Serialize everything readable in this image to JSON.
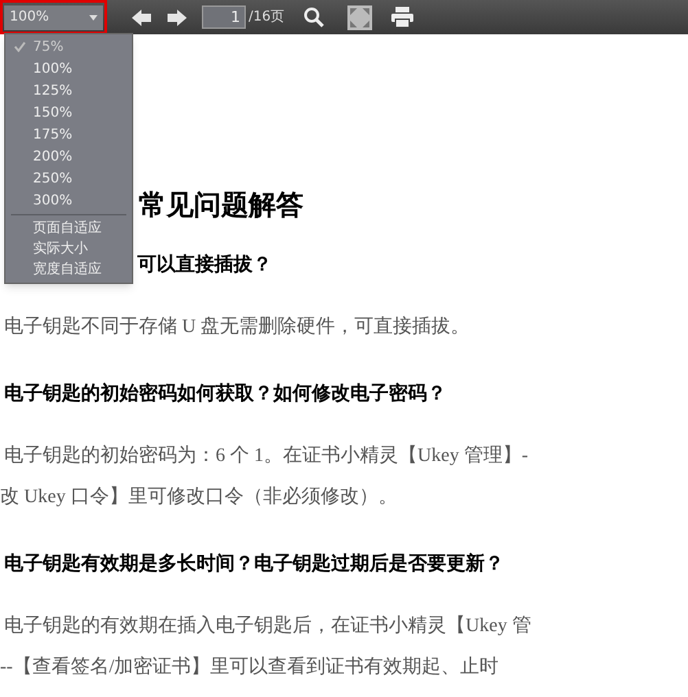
{
  "toolbar": {
    "zoom_value": "100%",
    "page_input": "1",
    "page_total": "/16页"
  },
  "zoom_menu": {
    "items": [
      {
        "label": "75%",
        "selected": true
      },
      {
        "label": "100%",
        "selected": false
      },
      {
        "label": "125%",
        "selected": false
      },
      {
        "label": "150%",
        "selected": false
      },
      {
        "label": "175%",
        "selected": false
      },
      {
        "label": "200%",
        "selected": false
      },
      {
        "label": "250%",
        "selected": false
      },
      {
        "label": "300%",
        "selected": false
      }
    ],
    "fit_items": [
      "页面自适应",
      "实际大小",
      "宽度自适应"
    ]
  },
  "document": {
    "title": "常见问题解答",
    "blocks": [
      {
        "kind": "partial_question",
        "text": "可以直接插拔？"
      },
      {
        "kind": "answer",
        "text": "电子钥匙不同于存储 U 盘无需删除硬件，可直接插拔。"
      },
      {
        "kind": "question",
        "text": "电子钥匙的初始密码如何获取？如何修改电子密码？"
      },
      {
        "kind": "answer",
        "text": "电子钥匙的初始密码为：6 个 1。在证书小精灵【Ukey 管理】-"
      },
      {
        "kind": "continuation",
        "text": "改 Ukey 口令】里可修改口令（非必须修改）。"
      },
      {
        "kind": "question",
        "text": "电子钥匙有效期是多长时间？电子钥匙过期后是否要更新？"
      },
      {
        "kind": "answer",
        "text": "电子钥匙的有效期在插入电子钥匙后，在证书小精灵【Ukey 管"
      },
      {
        "kind": "continuation",
        "text": "--【查看签名/加密证书】里可以查看到证书有效期起、止时"
      }
    ]
  }
}
